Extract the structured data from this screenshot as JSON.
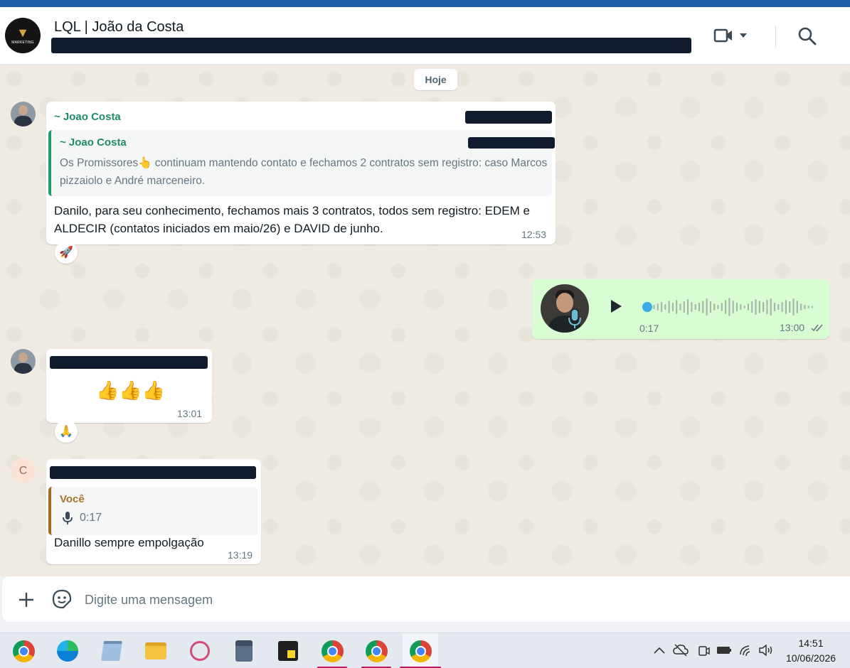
{
  "header": {
    "title": "LQL | João da Costa",
    "avatar_brand": "MARKETING"
  },
  "chat": {
    "date_chip": "Hoje",
    "messages": [
      {
        "sender": "~ Joao Costa",
        "quote": {
          "name": "~ Joao Costa",
          "text": "Os Promissores👆 continuam mantendo contato e fechamos 2 contratos sem registro: caso Marcos pizzaiolo e André marceneiro."
        },
        "text": "Danilo, para seu conhecimento, fechamos mais 3 contratos, todos sem registro: EDEM e ALDECIR (contatos iniciados em  maio/26) e DAVID de junho.",
        "time": "12:53",
        "reaction": "🚀"
      },
      {
        "type": "audio",
        "duration": "0:17",
        "time": "13:00",
        "progress": 0
      },
      {
        "text": "👍👍👍",
        "time": "13:01",
        "reaction": "🙏"
      },
      {
        "avatar_letter": "C",
        "quote": {
          "name": "Você",
          "duration": "0:17"
        },
        "text": "Danillo sempre empolgação",
        "time": "13:19"
      }
    ]
  },
  "composer": {
    "placeholder": "Digite uma mensagem"
  },
  "taskbar": {
    "time": "14:51",
    "date": "10/06/2026"
  }
}
